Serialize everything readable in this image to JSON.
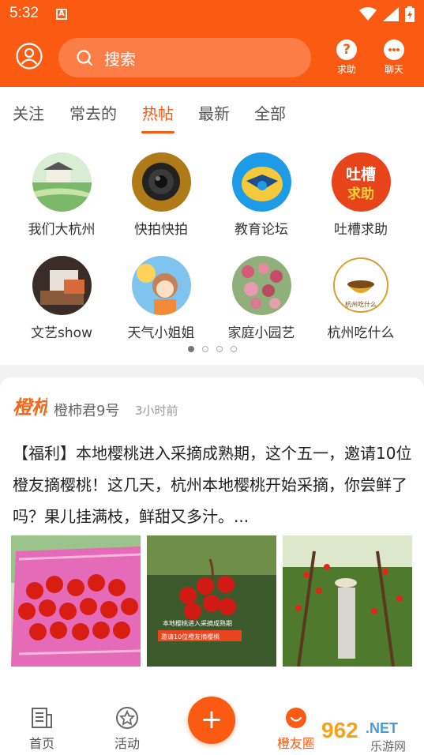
{
  "status_bar": {
    "time": "5:32",
    "notification_icon": "A"
  },
  "header": {
    "search_placeholder": "搜索",
    "help_label": "求助",
    "chat_label": "聊天"
  },
  "tabs": [
    {
      "label": "关注"
    },
    {
      "label": "常去的"
    },
    {
      "label": "热帖",
      "active": true
    },
    {
      "label": "最新"
    },
    {
      "label": "全部"
    }
  ],
  "forums": [
    {
      "label": "我们大杭州"
    },
    {
      "label": "快拍快拍"
    },
    {
      "label": "教育论坛"
    },
    {
      "label": "吐槽求助"
    },
    {
      "label": "文艺show"
    },
    {
      "label": "天气小姐姐"
    },
    {
      "label": "家庭小园艺"
    },
    {
      "label": "杭州吃什么"
    }
  ],
  "pager": {
    "count": 4,
    "active_index": 0
  },
  "post": {
    "author": "橙柿君9号",
    "time": "3小时前",
    "logo_text": "橙柿",
    "text": "【福利】本地樱桃进入采摘成熟期，这个五一，邀请10位橙友摘樱桃！这几天，杭州本地樱桃开始采摘，你尝鲜了吗？果儿挂满枝，鲜甜又多汁。...",
    "image2_caption1": "本地樱桃进入采摘成熟期",
    "image2_caption2": "邀请10位橙友摘樱桃"
  },
  "bottom_nav": {
    "home": "首页",
    "activity": "活动",
    "add": "+",
    "circle": "橙友圈"
  },
  "watermark": {
    "text1": "962",
    "text2": ".NET",
    "text3": "乐游网"
  },
  "colors": {
    "brand": "#fb5a12"
  }
}
